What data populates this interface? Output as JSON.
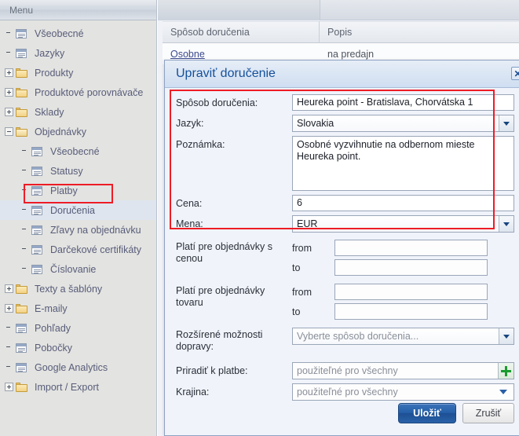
{
  "menu": {
    "header_title": "Menu",
    "items": [
      {
        "label": "Všeobecné",
        "icon": "document-icon",
        "indent": 1,
        "expander": "none",
        "selected": false
      },
      {
        "label": "Jazyky",
        "icon": "document-icon",
        "indent": 1,
        "expander": "none",
        "selected": false
      },
      {
        "label": "Produkty",
        "icon": "folder-icon",
        "indent": 0,
        "expander": "plus",
        "selected": false
      },
      {
        "label": "Produktové porovnávače",
        "icon": "folder-icon",
        "indent": 0,
        "expander": "plus",
        "selected": false
      },
      {
        "label": "Sklady",
        "icon": "folder-icon",
        "indent": 0,
        "expander": "plus",
        "selected": false
      },
      {
        "label": "Objednávky",
        "icon": "folder-open-icon",
        "indent": 0,
        "expander": "minus",
        "selected": false
      },
      {
        "label": "Všeobecné",
        "icon": "document-icon",
        "indent": 2,
        "expander": "none",
        "selected": false
      },
      {
        "label": "Statusy",
        "icon": "document-icon",
        "indent": 2,
        "expander": "none",
        "selected": false
      },
      {
        "label": "Platby",
        "icon": "document-icon",
        "indent": 2,
        "expander": "none",
        "selected": false
      },
      {
        "label": "Doručenia",
        "icon": "document-icon",
        "indent": 2,
        "expander": "none",
        "selected": true
      },
      {
        "label": "Zľavy na objednávku",
        "icon": "document-icon",
        "indent": 2,
        "expander": "none",
        "selected": false
      },
      {
        "label": "Darčekové certifikáty",
        "icon": "document-icon",
        "indent": 2,
        "expander": "none",
        "selected": false
      },
      {
        "label": "Číslovanie",
        "icon": "document-icon",
        "indent": 2,
        "expander": "none",
        "selected": false
      },
      {
        "label": "Texty a šablóny",
        "icon": "folder-icon",
        "indent": 0,
        "expander": "plus",
        "selected": false
      },
      {
        "label": "E-maily",
        "icon": "folder-icon",
        "indent": 0,
        "expander": "plus",
        "selected": false
      },
      {
        "label": "Pohľady",
        "icon": "document-icon",
        "indent": 1,
        "expander": "none",
        "selected": false
      },
      {
        "label": "Pobočky",
        "icon": "document-icon",
        "indent": 1,
        "expander": "none",
        "selected": false
      },
      {
        "label": "Google Analytics",
        "icon": "document-icon",
        "indent": 1,
        "expander": "none",
        "selected": false
      },
      {
        "label": "Import / Export",
        "icon": "folder-icon",
        "indent": 0,
        "expander": "plus",
        "selected": false
      }
    ]
  },
  "grid": {
    "columns": [
      "Spôsob doručenia",
      "Popis"
    ],
    "rows": [
      {
        "method": "Osobne",
        "description": "na predajn"
      }
    ]
  },
  "dialog": {
    "title": "Upraviť doručenie",
    "close_label": "✕",
    "fields": {
      "delivery_method": {
        "label": "Spôsob doručenia:",
        "value": "Heureka point - Bratislava, Chorvátska 1"
      },
      "language": {
        "label": "Jazyk:",
        "value": "Slovakia"
      },
      "note": {
        "label": "Poznámka:",
        "value": "Osobné vyzvihnutie na odbernom mieste\nHeureka point."
      },
      "price": {
        "label": "Cena:",
        "value": "6"
      },
      "currency": {
        "label": "Mena:",
        "value": "EUR"
      },
      "orders_price": {
        "label": "Platí pre objednávky s cenou",
        "from_label": "from",
        "to_label": "to",
        "from_value": "",
        "to_value": ""
      },
      "orders_goods": {
        "label": "Platí pre objednávky tovaru",
        "from_label": "from",
        "to_label": "to",
        "from_value": "",
        "to_value": ""
      },
      "extended": {
        "label": "Rozšírené možnosti dopravy:",
        "placeholder": "Vyberte spôsob doručenia..."
      },
      "assign_payment": {
        "label": "Priradiť k platbe:",
        "placeholder": "použiteľné pro všechny"
      },
      "country": {
        "label": "Krajina:",
        "placeholder": "použiteľné pro všechny"
      }
    },
    "buttons": {
      "save": "Uložiť",
      "cancel": "Zrušiť"
    }
  },
  "annotations": {
    "accent_color": "#ee1c25"
  }
}
